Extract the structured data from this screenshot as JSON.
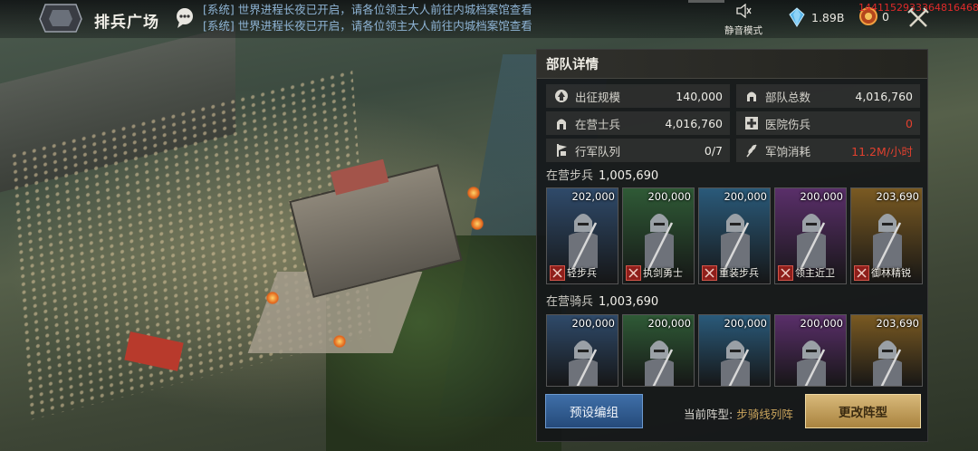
{
  "header": {
    "title": "排兵广场",
    "system_messages": [
      {
        "tag": "[系统]",
        "text": "世界进程长夜已开启，请各位领主大人前往内城档案馆查看"
      },
      {
        "tag": "[系统]",
        "text": "世界进程长夜已开启，请各位领主大人前往内城档案馆查看"
      }
    ],
    "mute_label": "静音模式",
    "crystal_value": "1.89B",
    "coin_value": "0",
    "debug_id": "1441152933364816468"
  },
  "panel": {
    "title": "部队详情",
    "stats": [
      {
        "icon": "helmet-up-icon",
        "name": "出征规模",
        "value": "140,000"
      },
      {
        "icon": "helmet-icon",
        "name": "部队总数",
        "value": "4,016,760"
      },
      {
        "icon": "camp-soldier-icon",
        "name": "在营士兵",
        "value": "4,016,760"
      },
      {
        "icon": "hospital-cross-icon",
        "name": "医院伤兵",
        "value": "0"
      },
      {
        "icon": "march-flag-icon",
        "name": "行军队列",
        "value": "0/7"
      },
      {
        "icon": "wheat-icon",
        "name": "军饷消耗",
        "value": "11.2M/小时"
      }
    ],
    "infantry": {
      "label": "在营步兵",
      "total": "1,005,690",
      "units": [
        {
          "count": "202,000",
          "name": "轻步兵",
          "color": "#2f4a6a"
        },
        {
          "count": "200,000",
          "name": "执剑勇士",
          "color": "#2f5a36"
        },
        {
          "count": "200,000",
          "name": "重装步兵",
          "color": "#2a5a7a"
        },
        {
          "count": "200,000",
          "name": "领主近卫",
          "color": "#5a2f6a"
        },
        {
          "count": "203,690",
          "name": "御林精锐",
          "color": "#7a5a22"
        }
      ]
    },
    "cavalry": {
      "label": "在营骑兵",
      "total": "1,003,690",
      "units": [
        {
          "count": "200,000",
          "color": "#2f4a6a"
        },
        {
          "count": "200,000",
          "color": "#2f5a36"
        },
        {
          "count": "200,000",
          "color": "#2a5a7a"
        },
        {
          "count": "200,000",
          "color": "#5a2f6a"
        },
        {
          "count": "203,690",
          "color": "#7a5a22"
        }
      ]
    },
    "preset_button": "预设编组",
    "formation_label": "当前阵型:",
    "formation_value": "步骑线列阵",
    "change_button": "更改阵型"
  }
}
